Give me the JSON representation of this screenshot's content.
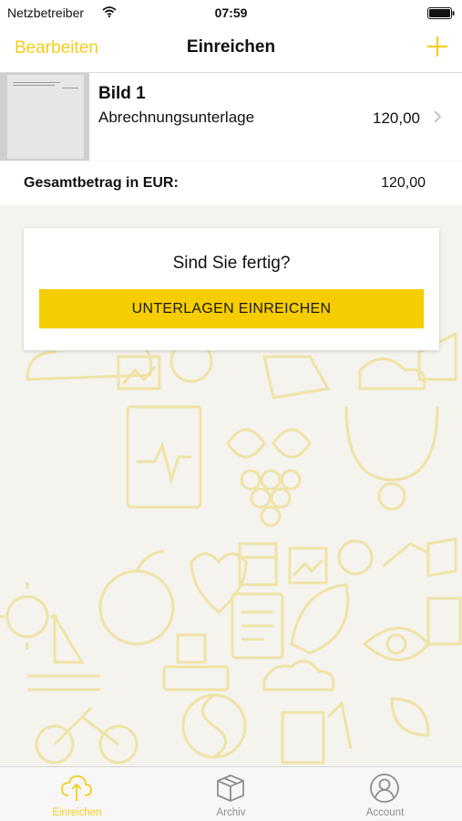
{
  "status_bar": {
    "carrier": "Netzbetreiber",
    "time": "07:59"
  },
  "nav": {
    "edit_label": "Bearbeiten",
    "title": "Einreichen",
    "add_icon": "plus-icon"
  },
  "documents": [
    {
      "name": "Bild 1",
      "type": "Abrechnungsunterlage",
      "amount": "120,00"
    }
  ],
  "total": {
    "label": "Gesamtbetrag in EUR:",
    "value": "120,00"
  },
  "dialog": {
    "question": "Sind Sie fertig?",
    "submit_label": "UNTERLAGEN EINREICHEN"
  },
  "tabs": [
    {
      "label": "Einreichen",
      "icon": "cloud-upload-icon",
      "active": true
    },
    {
      "label": "Archiv",
      "icon": "box-icon",
      "active": false
    },
    {
      "label": "Account",
      "icon": "person-icon",
      "active": false
    }
  ],
  "colors": {
    "accent": "#f5cd1e",
    "button": "#f5cd00",
    "background": "#f4f3ee"
  }
}
